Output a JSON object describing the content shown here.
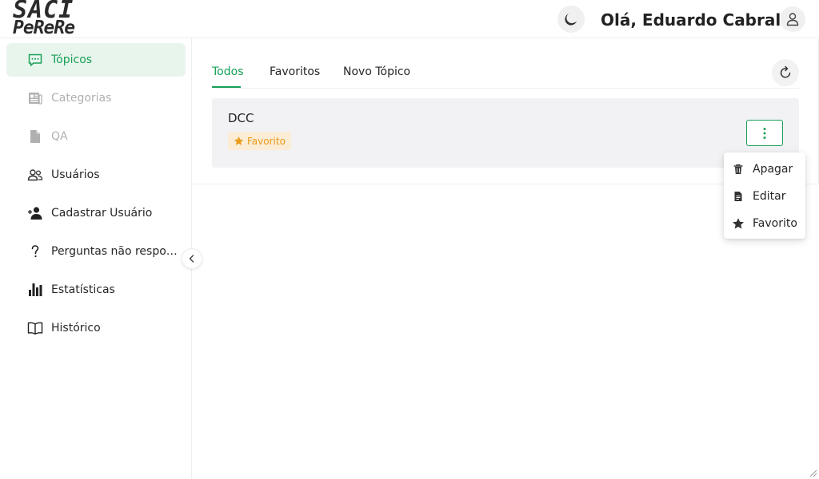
{
  "app": {
    "logo_line1": "SACI",
    "logo_line2": "PeReRe",
    "greeting": "Olá, Eduardo Cabral!"
  },
  "sidebar": {
    "items": [
      {
        "label": "Tópicos",
        "icon": "chat-icon",
        "state": "active"
      },
      {
        "label": "Categorias",
        "icon": "newspaper-icon",
        "state": "disabled"
      },
      {
        "label": "QA",
        "icon": "document-icon",
        "state": "disabled"
      },
      {
        "label": "Usuários",
        "icon": "people-icon",
        "state": "normal"
      },
      {
        "label": "Cadastrar Usuário",
        "icon": "person-add-icon",
        "state": "normal"
      },
      {
        "label": "Perguntas não respondidas",
        "icon": "question-icon",
        "state": "normal"
      },
      {
        "label": "Estatísticas",
        "icon": "bar-chart-icon",
        "state": "normal"
      },
      {
        "label": "Histórico",
        "icon": "book-icon",
        "state": "normal"
      }
    ]
  },
  "tabs": [
    {
      "label": "Todos",
      "active": true
    },
    {
      "label": "Favoritos",
      "active": false
    },
    {
      "label": "Novo Tópico",
      "active": false
    }
  ],
  "topics": [
    {
      "name": "DCC",
      "tag": "Favorito"
    }
  ],
  "dropdown": {
    "items": [
      {
        "label": "Apagar",
        "icon": "trash-icon"
      },
      {
        "label": "Editar",
        "icon": "file-edit-icon"
      },
      {
        "label": "Favorito",
        "icon": "star-icon"
      }
    ]
  },
  "colors": {
    "accent": "#18a058",
    "accent_bg": "#e8f5ec",
    "favorite": "#e99a1a",
    "favorite_bg": "#fbecd5"
  }
}
